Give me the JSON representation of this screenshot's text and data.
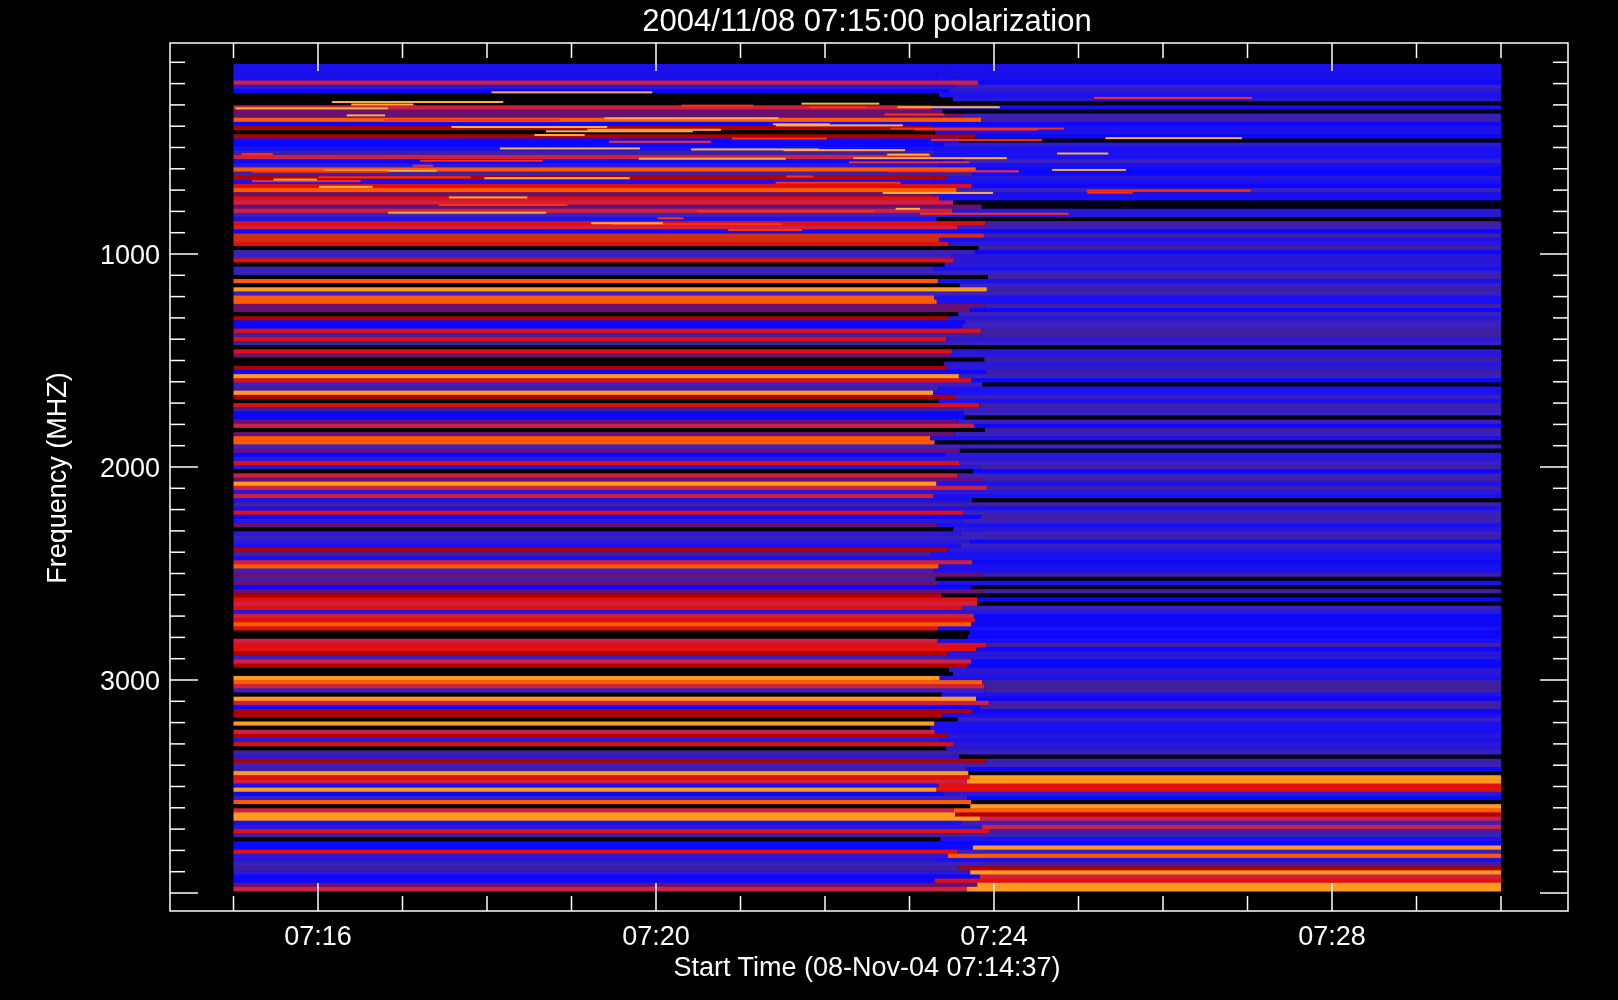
{
  "title": "2004/11/08 07:15:00 polarization",
  "y_axis": {
    "label": "Frequency (MHZ)",
    "ticks": [
      "1000",
      "2000",
      "3000"
    ]
  },
  "x_axis": {
    "label": "Start Time (08-Nov-04 07:14:37)",
    "ticks": [
      "07:16",
      "07:20",
      "07:24",
      "07:28"
    ]
  }
}
